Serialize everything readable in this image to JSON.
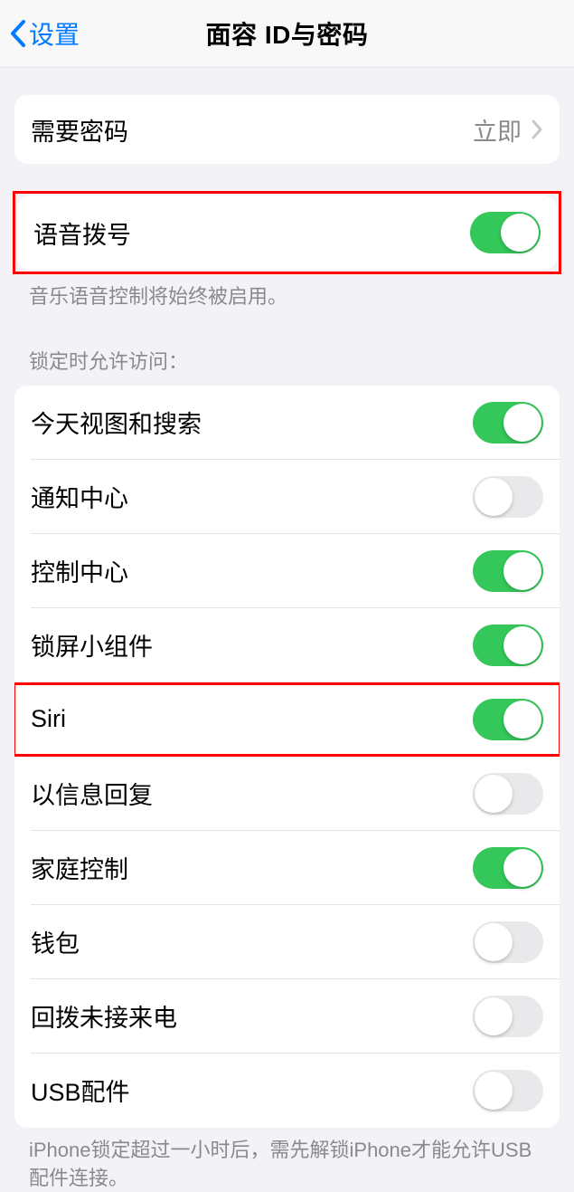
{
  "header": {
    "back_label": "设置",
    "title": "面容 ID与密码"
  },
  "passcode_group": {
    "require_passcode_label": "需要密码",
    "require_passcode_value": "立即"
  },
  "voice_dial": {
    "label": "语音拨号",
    "enabled": true,
    "footer": "音乐语音控制将始终被启用。"
  },
  "lock_access": {
    "header": "锁定时允许访问：",
    "items": [
      {
        "label": "今天视图和搜索",
        "enabled": true,
        "highlight": false
      },
      {
        "label": "通知中心",
        "enabled": false,
        "highlight": false
      },
      {
        "label": "控制中心",
        "enabled": true,
        "highlight": false
      },
      {
        "label": "锁屏小组件",
        "enabled": true,
        "highlight": false
      },
      {
        "label": "Siri",
        "enabled": true,
        "highlight": true
      },
      {
        "label": "以信息回复",
        "enabled": false,
        "highlight": false
      },
      {
        "label": "家庭控制",
        "enabled": true,
        "highlight": false
      },
      {
        "label": "钱包",
        "enabled": false,
        "highlight": false
      },
      {
        "label": "回拨未接来电",
        "enabled": false,
        "highlight": false
      },
      {
        "label": "USB配件",
        "enabled": false,
        "highlight": false
      }
    ],
    "footer": "iPhone锁定超过一小时后，需先解锁iPhone才能允许USB配件连接。"
  }
}
